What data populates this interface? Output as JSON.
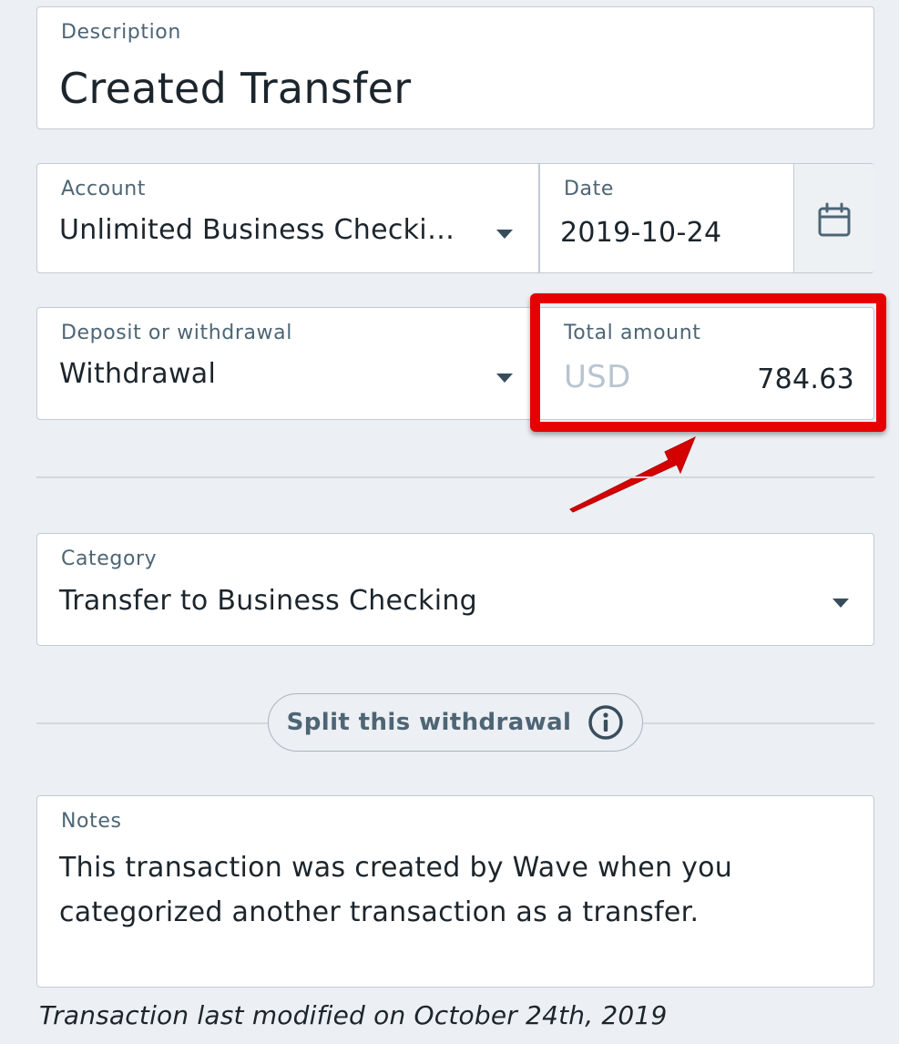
{
  "description": {
    "label": "Description",
    "value": "Created Transfer"
  },
  "account": {
    "label": "Account",
    "value": "Unlimited Business Checki…"
  },
  "date": {
    "label": "Date",
    "value": "2019-10-24",
    "icon": "calendar-icon"
  },
  "type": {
    "label": "Deposit or withdrawal",
    "value": "Withdrawal"
  },
  "amount": {
    "label": "Total amount",
    "currency": "USD",
    "value": "784.63"
  },
  "category": {
    "label": "Category",
    "value": "Transfer to Business Checking"
  },
  "split": {
    "label": "Split this withdrawal",
    "icon": "info-icon"
  },
  "notes": {
    "label": "Notes",
    "value": "This transaction was created by Wave when you categorized another transaction as a transfer."
  },
  "footer": {
    "text": "Transaction last modified on October 24th, 2019"
  },
  "annotation": {
    "highlight_color": "#e60000",
    "arrow_color": "#d40000"
  }
}
